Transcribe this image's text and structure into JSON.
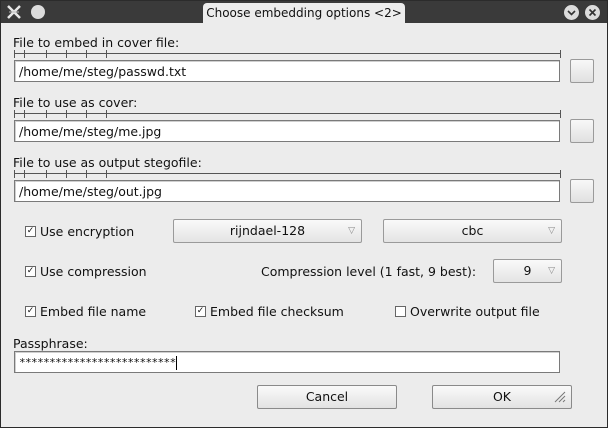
{
  "window": {
    "title": "Choose embedding options <2>"
  },
  "fields": {
    "embed_label": "File to embed in cover file:",
    "embed_value": "/home/me/steg/passwd.txt",
    "cover_label": "File to use as cover:",
    "cover_value": "/home/me/steg/me.jpg",
    "output_label": "File to use as output stegofile:",
    "output_value": "/home/me/steg/out.jpg"
  },
  "options": {
    "encryption_label": "Use encryption",
    "encryption_checked": true,
    "algorithm": "rijndael-128",
    "mode": "cbc",
    "compression_label": "Use compression",
    "compression_checked": true,
    "compression_level_label": "Compression level (1 fast, 9 best):",
    "compression_level": "9",
    "embed_name_label": "Embed file name",
    "embed_name_checked": true,
    "embed_checksum_label": "Embed file checksum",
    "embed_checksum_checked": true,
    "overwrite_label": "Overwrite output file",
    "overwrite_checked": false
  },
  "passphrase": {
    "label": "Passphrase:",
    "value": "**************************"
  },
  "buttons": {
    "cancel": "Cancel",
    "ok": "OK"
  }
}
